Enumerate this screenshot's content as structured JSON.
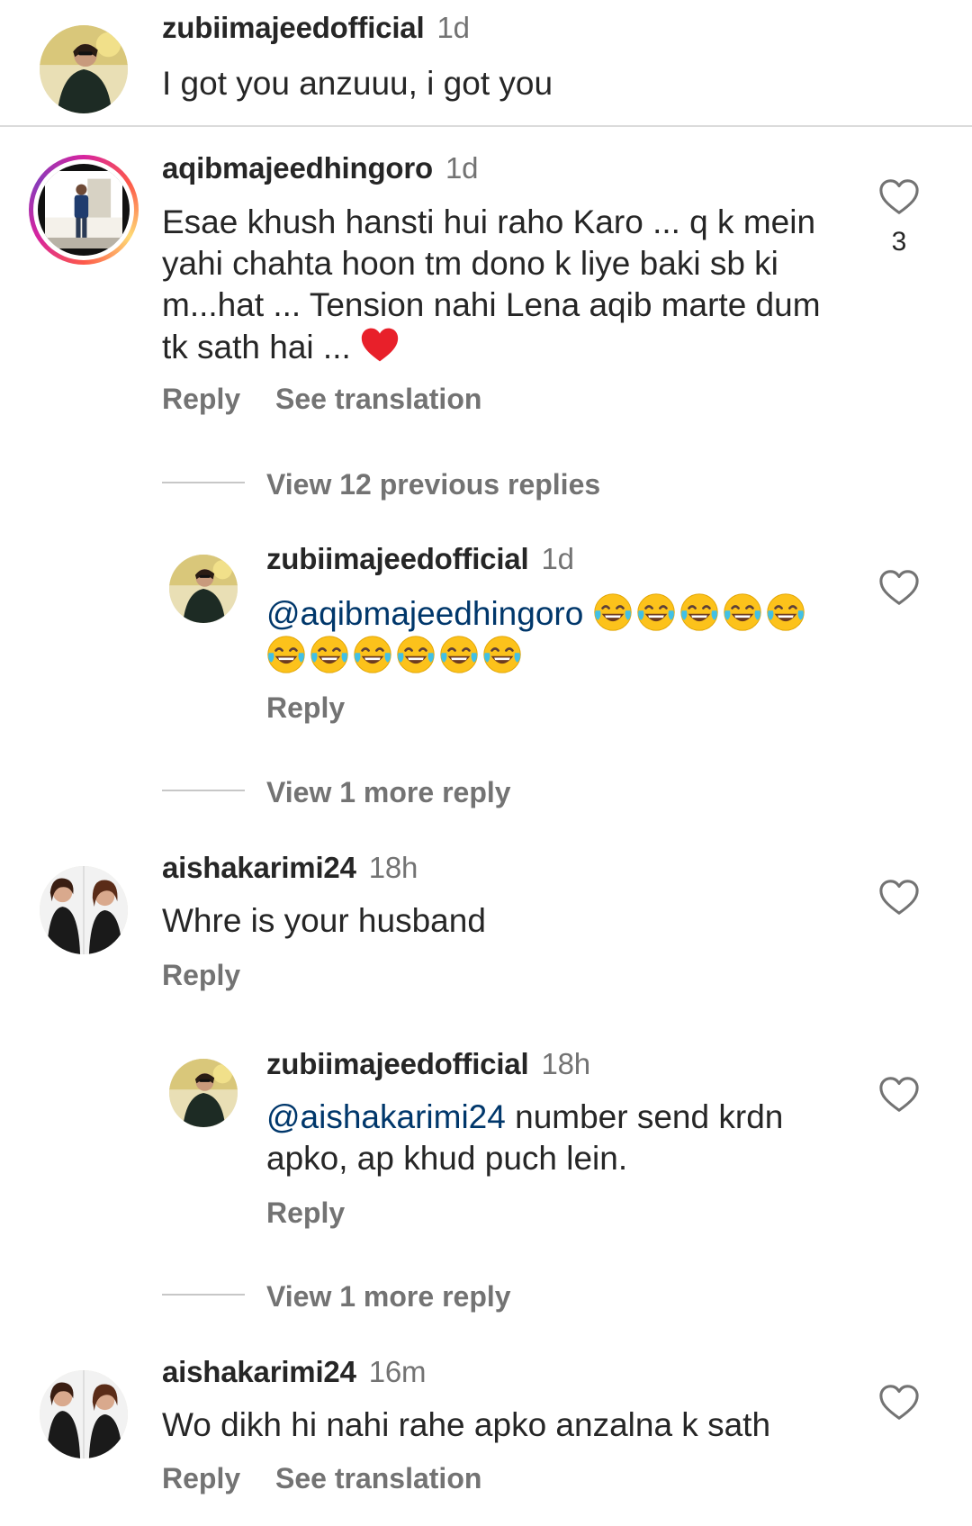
{
  "comments": [
    {
      "username": "zubiimajeedofficial",
      "time": "1d",
      "text": "I got you anzuuu, i got you"
    },
    {
      "username": "aqibmajeedhingoro",
      "time": "1d",
      "text": "Esae khush hansti hui raho Karo ... q k mein yahi chahta hoon tm dono k liye baki sb ki m...hat ... Tension nahi Lena aqib marte dum tk sath hai ...",
      "likes": "3",
      "reply": "Reply",
      "translate": "See translation",
      "view_replies": "View 12 previous replies",
      "replies": [
        {
          "username": "zubiimajeedofficial",
          "time": "1d",
          "mention": "@aqibmajeedhingoro",
          "reply": "Reply"
        }
      ],
      "view_more": "View 1 more reply"
    },
    {
      "username": "aishakarimi24",
      "time": "18h",
      "text": "Whre is your husband",
      "reply": "Reply",
      "replies": [
        {
          "username": "zubiimajeedofficial",
          "time": "18h",
          "mention": "@aishakarimi24",
          "text": " number send krdn apko, ap khud puch lein.",
          "reply": "Reply"
        }
      ],
      "view_more": "View 1 more reply"
    },
    {
      "username": "aishakarimi24",
      "time": "16m",
      "text": "Wo dikh hi nahi rahe apko anzalna k sath",
      "reply": "Reply",
      "translate": "See translation"
    }
  ],
  "colors": {
    "text": "#262626",
    "secondary": "#737373",
    "mention": "#00376b",
    "divider": "#dbdbdb"
  },
  "icons": [
    "heart-outline-icon",
    "laughing-tears-emoji",
    "red-heart-emoji"
  ]
}
